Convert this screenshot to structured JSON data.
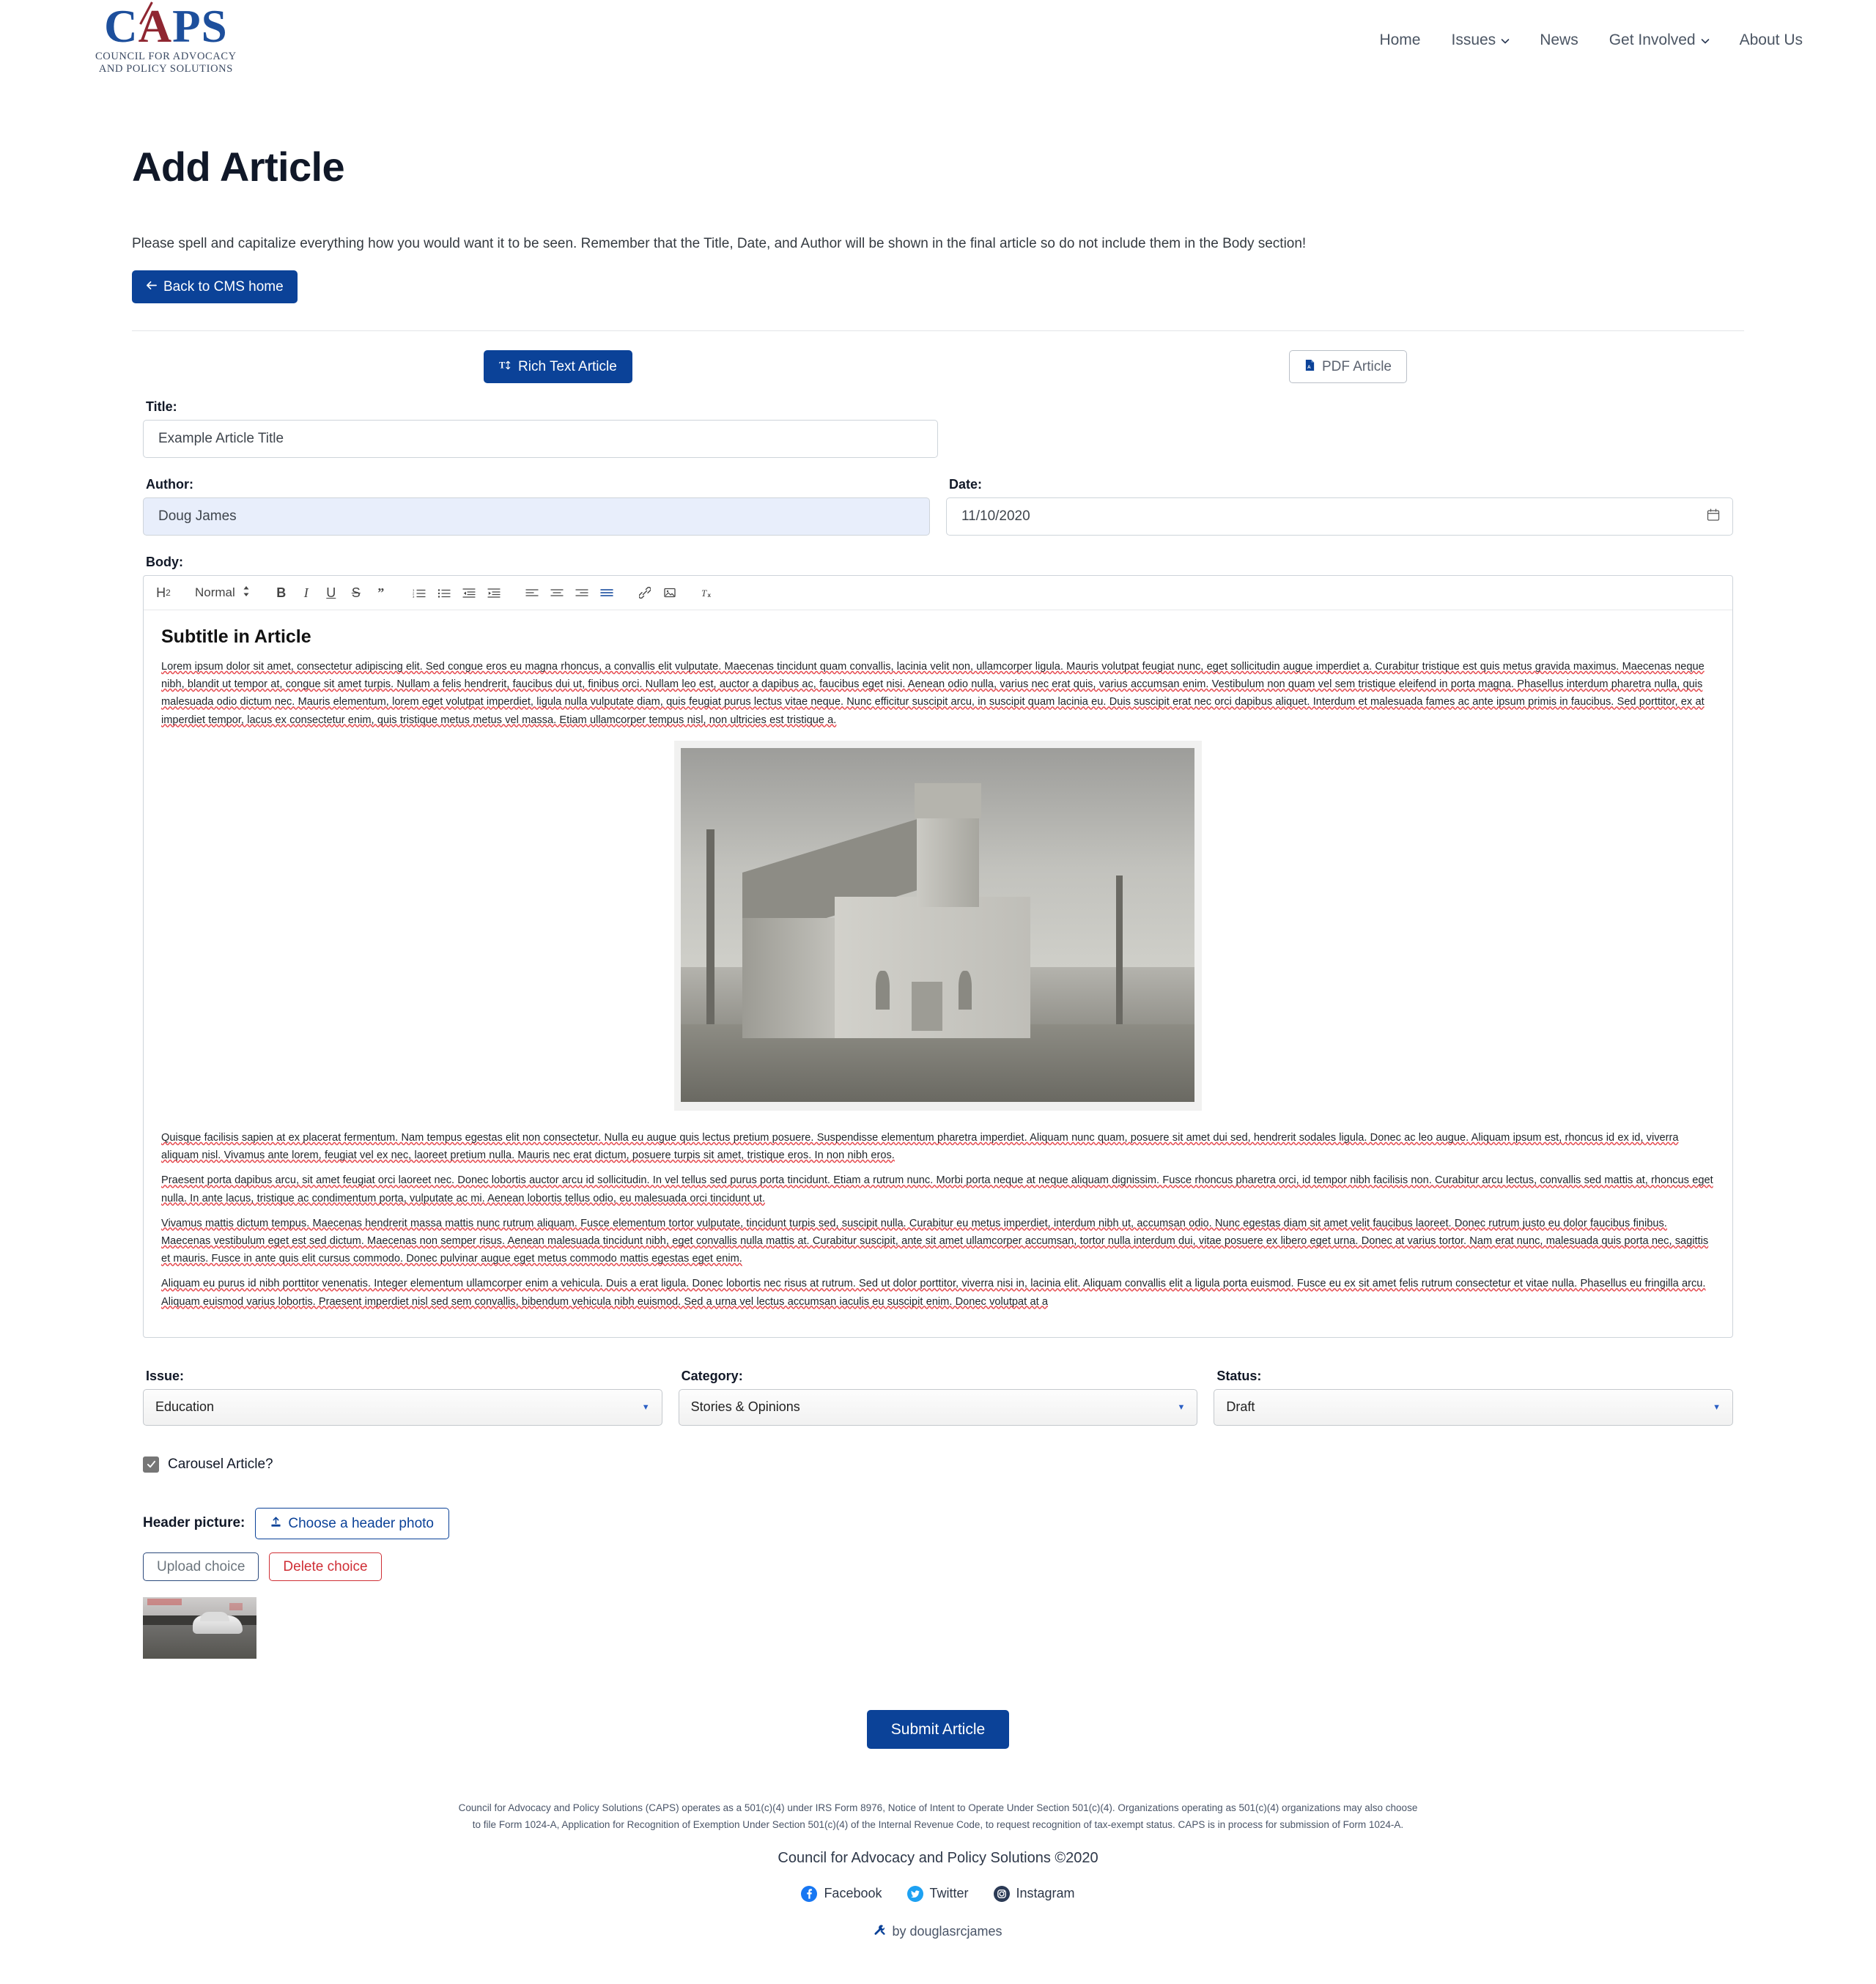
{
  "header": {
    "logo": {
      "word_c": "C",
      "word_a": "A",
      "word_ps": "PS",
      "line1": "COUNCIL FOR ADVOCACY",
      "line2": "AND POLICY SOLUTIONS"
    },
    "nav": [
      {
        "label": "Home",
        "has_caret": false
      },
      {
        "label": "Issues",
        "has_caret": true
      },
      {
        "label": "News",
        "has_caret": false
      },
      {
        "label": "Get Involved",
        "has_caret": true
      },
      {
        "label": "About Us",
        "has_caret": false
      }
    ]
  },
  "page": {
    "title": "Add Article",
    "description": "Please spell and capitalize everything how you would want it to be seen. Remember that the Title, Date, and Author will be shown in the final article so do not include them in the Body section!",
    "back_button": "Back to CMS home"
  },
  "modes": {
    "rich_text": "Rich Text Article",
    "pdf": "PDF Article"
  },
  "form": {
    "title_label": "Title:",
    "title_value": "Example Article Title",
    "author_label": "Author:",
    "author_value": "Doug James",
    "date_label": "Date:",
    "date_value": "11/10/2020",
    "body_label": "Body:"
  },
  "toolbar": {
    "heading": "H2",
    "format": "Normal",
    "bold": "B",
    "italic": "I",
    "underline": "U",
    "strike": "S",
    "blockquote": "”",
    "ordered_list": "ordered-list",
    "bullet_list": "bullet-list",
    "outdent": "outdent",
    "indent": "indent",
    "align_left": "align-left",
    "align_center": "align-center",
    "align_right": "align-right",
    "align_justify": "align-justify",
    "link": "link",
    "image": "image",
    "clear_format": "clear-format"
  },
  "document": {
    "subtitle": "Subtitle in Article",
    "paragraph1": "Lorem ipsum dolor sit amet, consectetur adipiscing elit. Sed congue eros eu magna rhoncus, a convallis elit vulputate. Maecenas tincidunt quam convallis, lacinia velit non, ullamcorper ligula. Mauris volutpat feugiat nunc, eget sollicitudin augue imperdiet a. Curabitur tristique est quis metus gravida maximus. Maecenas neque nibh, blandit ut tempor at, congue sit amet turpis. Nullam a felis hendrerit, faucibus dui ut, finibus orci. Nullam leo est, auctor a dapibus ac, faucibus eget nisi. Aenean odio nulla, varius nec erat quis, varius accumsan enim. Vestibulum non quam vel sem tristique eleifend in porta magna. Phasellus interdum pharetra nulla, quis malesuada odio dictum nec. Mauris elementum, lorem eget volutpat imperdiet, ligula nulla vulputate diam, quis feugiat purus lectus vitae neque. Nunc efficitur suscipit arcu, in suscipit quam lacinia eu. Duis suscipit erat nec orci dapibus aliquet. Interdum et malesuada fames ac ante ipsum primis in faucibus. Sed porttitor, ex at imperdiet tempor, lacus ex consectetur enim, quis tristique metus metus vel massa. Etiam ullamcorper tempus nisl, non ultricies est tristique a.",
    "image_alt": "Black and white photograph of a historic white wooden church with a steeple, bare trees on either side",
    "paragraph2": "Quisque facilisis sapien at ex placerat fermentum. Nam tempus egestas elit non consectetur. Nulla eu augue quis lectus pretium posuere. Suspendisse elementum pharetra imperdiet. Aliquam nunc quam, posuere sit amet dui sed, hendrerit sodales ligula. Donec ac leo augue. Aliquam ipsum est, rhoncus id ex id, viverra aliquam nisl. Vivamus ante lorem, feugiat vel ex nec, laoreet pretium nulla. Mauris nec erat dictum, posuere turpis sit amet, tristique eros. In non nibh eros.",
    "paragraph3": "Praesent porta dapibus arcu, sit amet feugiat orci laoreet nec. Donec lobortis auctor arcu id sollicitudin. In vel tellus sed purus porta tincidunt. Etiam a rutrum nunc. Morbi porta neque at neque aliquam dignissim. Fusce rhoncus pharetra orci, id tempor nibh facilisis non. Curabitur arcu lectus, convallis sed mattis at, rhoncus eget nulla. In ante lacus, tristique ac condimentum porta, vulputate ac mi. Aenean lobortis tellus odio, eu malesuada orci tincidunt ut.",
    "paragraph4": "Vivamus mattis dictum tempus. Maecenas hendrerit massa mattis nunc rutrum aliquam. Fusce elementum tortor vulputate, tincidunt turpis sed, suscipit nulla. Curabitur eu metus imperdiet, interdum nibh ut, accumsan odio. Nunc egestas diam sit amet velit faucibus laoreet. Donec rutrum justo eu dolor faucibus finibus. Maecenas vestibulum eget est sed dictum. Maecenas non semper risus. Aenean malesuada tincidunt nibh, eget convallis nulla mattis at. Curabitur suscipit, ante sit amet ullamcorper accumsan, tortor nulla interdum dui, vitae posuere ex libero eget urna. Donec at varius tortor. Nam erat nunc, malesuada quis porta nec, sagittis et mauris. Fusce in ante quis elit cursus commodo. Donec pulvinar augue eget metus commodo mattis egestas eget enim.",
    "paragraph5": "Aliquam eu purus id nibh porttitor venenatis. Integer elementum ullamcorper enim a vehicula. Duis a erat ligula. Donec lobortis nec risus at rutrum. Sed ut dolor porttitor, viverra nisi in, lacinia elit. Aliquam convallis elit a ligula porta euismod. Fusce eu ex sit amet felis rutrum consectetur et vitae nulla. Phasellus eu fringilla arcu. Aliquam euismod varius lobortis. Praesent imperdiet nisl sed sem convallis, bibendum vehicula nibh euismod. Sed a urna vel lectus accumsan iaculis eu suscipit enim. Donec volutpat at a"
  },
  "selects": {
    "issue_label": "Issue:",
    "issue_value": "Education",
    "category_label": "Category:",
    "category_value": "Stories & Opinions",
    "status_label": "Status:",
    "status_value": "Draft"
  },
  "carousel": {
    "label": "Carousel Article?",
    "checked": true
  },
  "header_picture": {
    "label": "Header picture:",
    "choose_button": "Choose a header photo",
    "upload_button": "Upload choice",
    "delete_button": "Delete choice",
    "thumbnail_alt": "White sports car driving on a road"
  },
  "submit": {
    "label": "Submit Article"
  },
  "footer": {
    "legal": "Council for Advocacy and Policy Solutions (CAPS) operates as a 501(c)(4) under IRS Form 8976, Notice of Intent to Operate Under Section 501(c)(4). Organizations operating as 501(c)(4) organizations may also choose to file Form 1024-A, Application for Recognition of Exemption Under Section 501(c)(4) of the Internal Revenue Code, to request recognition of tax-exempt status. CAPS is in process for submission of Form 1024-A.",
    "copyright": "Council for Advocacy and Policy Solutions  ©2020",
    "social": [
      {
        "label": "Facebook",
        "icon": "facebook-icon"
      },
      {
        "label": "Twitter",
        "icon": "twitter-icon"
      },
      {
        "label": "Instagram",
        "icon": "instagram-icon"
      }
    ],
    "byline": "by douglasrcjames"
  },
  "colors": {
    "brand_blue": "#0b4298",
    "brand_red": "#8f2631",
    "danger": "#cf2e35"
  }
}
